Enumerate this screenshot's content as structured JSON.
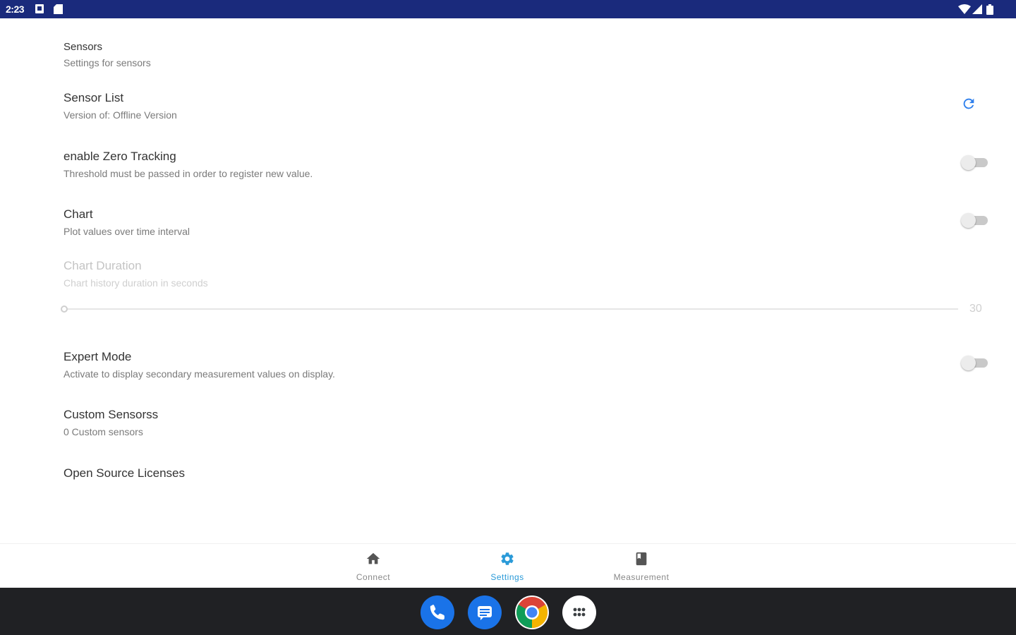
{
  "status_bar": {
    "time": "2:23",
    "left_icons": [
      "notification-icon",
      "sd-card-icon"
    ],
    "right_icons": [
      "wifi-icon",
      "cell-signal-icon",
      "battery-icon"
    ],
    "background": "#1a2a7c"
  },
  "settings": {
    "category": {
      "title": "Sensors",
      "summary": "Settings for sensors"
    },
    "sensor_list": {
      "title": "Sensor List",
      "summary": "Version of: Offline Version",
      "action_icon": "refresh-icon"
    },
    "zero_tracking": {
      "title": "enable Zero Tracking",
      "summary": "Threshold must be passed in order to register new value.",
      "enabled": false
    },
    "chart": {
      "title": "Chart",
      "summary": "Plot values over time interval",
      "enabled": false
    },
    "chart_duration": {
      "title": "Chart Duration",
      "summary": "Chart history duration in seconds",
      "value": "30",
      "slider_fraction": 0.0,
      "disabled": true
    },
    "expert_mode": {
      "title": "Expert Mode",
      "summary": "Activate to display secondary measurement values on display.",
      "enabled": false
    },
    "custom_sensors": {
      "title": "Custom Sensorss",
      "summary": "0 Custom sensors"
    },
    "licenses": {
      "title": "Open Source Licenses"
    }
  },
  "bottom_nav": {
    "items": [
      {
        "label": "Connect",
        "icon": "home-icon",
        "active": false
      },
      {
        "label": "Settings",
        "icon": "gear-icon",
        "active": true
      },
      {
        "label": "Measurement",
        "icon": "book-icon",
        "active": false
      }
    ],
    "active_color": "#2a9ad8"
  },
  "dock": {
    "apps": [
      "phone-icon",
      "messages-icon",
      "chrome-icon",
      "app-drawer-icon"
    ]
  }
}
